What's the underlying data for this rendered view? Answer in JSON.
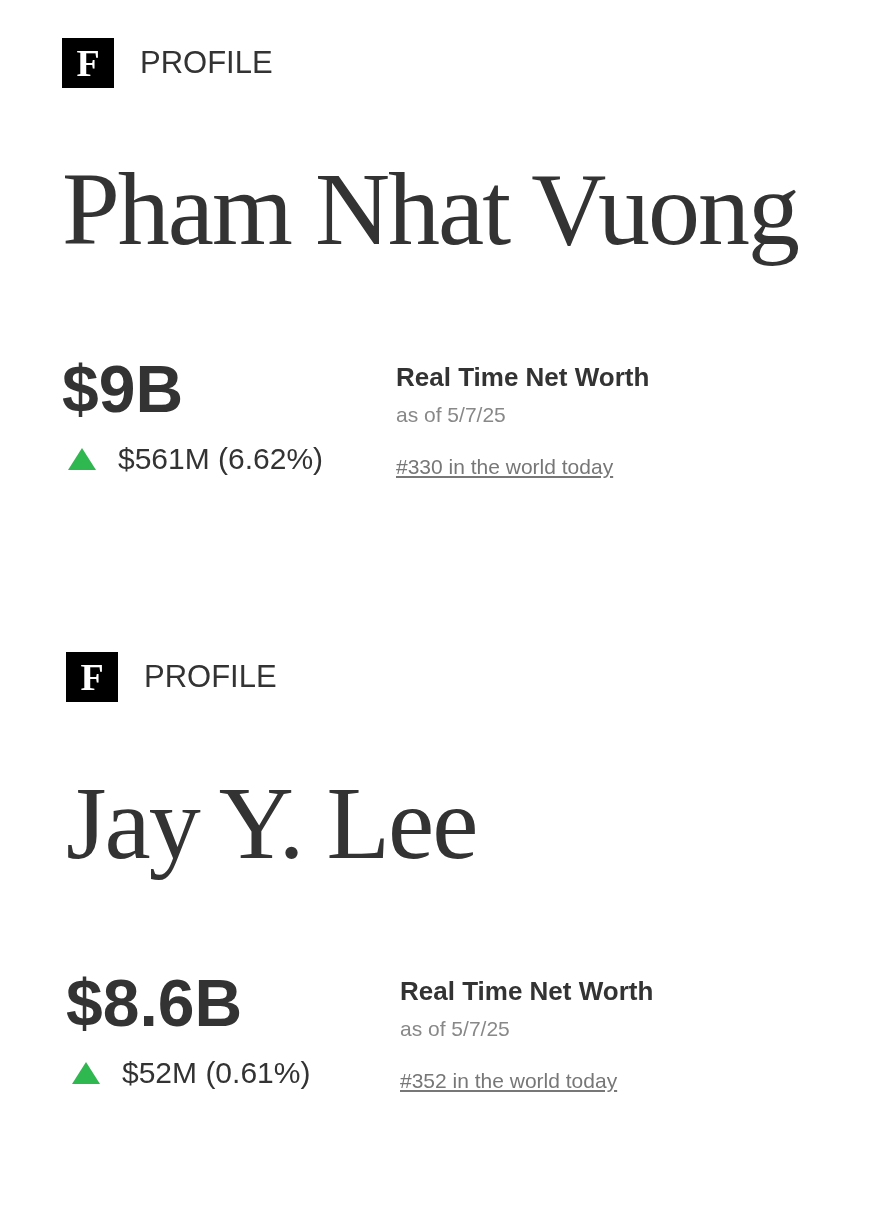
{
  "profiles": [
    {
      "logo": "F",
      "label": "PROFILE",
      "name": "Pham Nhat Vuong",
      "net_worth": "$9B",
      "change": {
        "rising": true,
        "text": "$561M (6.62%)"
      },
      "heading": "Real Time Net Worth",
      "as_of": "as of 5/7/25",
      "rank_link": "#330 in the world today"
    },
    {
      "logo": "F",
      "label": "PROFILE",
      "name": "Jay Y. Lee",
      "net_worth": "$8.6B",
      "change": {
        "rising": true,
        "text": "$52M (0.61%)"
      },
      "heading": "Real Time Net Worth",
      "as_of": "as of 5/7/25",
      "rank_link": "#352 in the world today"
    }
  ]
}
